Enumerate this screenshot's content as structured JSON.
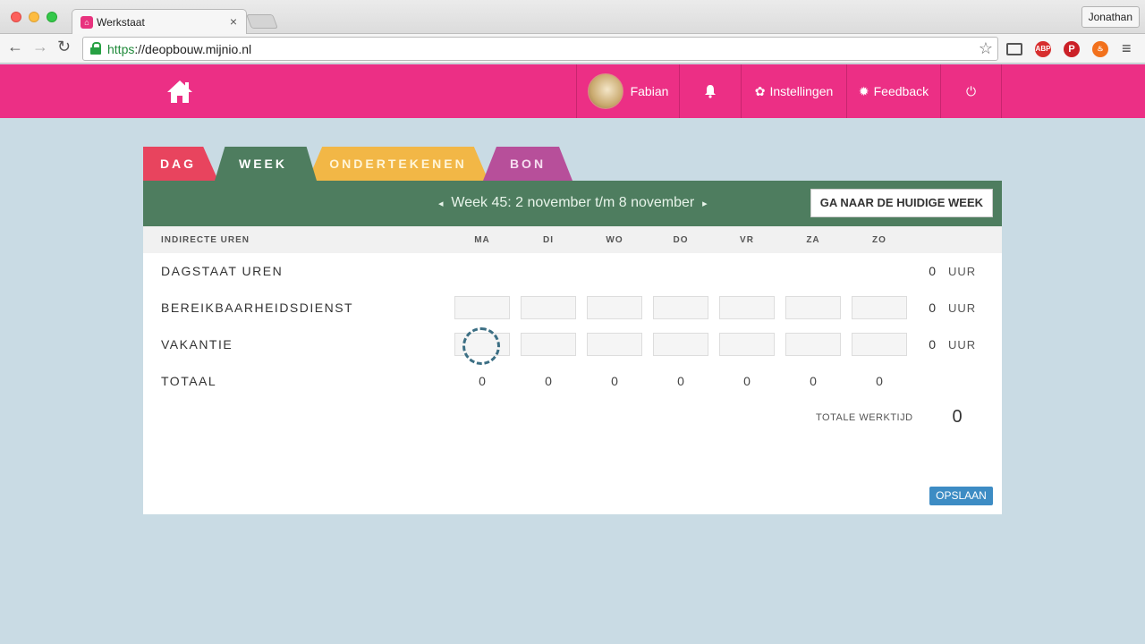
{
  "browser": {
    "tab_title": "Werkstaat",
    "tab_close": "×",
    "favicon": "⌂",
    "profile": "Jonathan",
    "url_scheme": "https",
    "url_rest": "://deopbouw.mijnio.nl",
    "nav_back": "←",
    "nav_forward": "→",
    "nav_reload": "↻",
    "star": "☆",
    "menu": "≡",
    "ext_abp": "ABP",
    "ext_pinterest": "P",
    "ext_fire": "♨"
  },
  "header": {
    "user_name": "Fabian",
    "settings_label": "Instellingen",
    "feedback_label": "Feedback",
    "settings_icon": "✿",
    "feedback_icon": "✹",
    "power_icon": "⏻",
    "color": "#ec2f85"
  },
  "tabs": [
    {
      "label": "DAG"
    },
    {
      "label": "WEEK"
    },
    {
      "label": "ONDERTEKENEN"
    },
    {
      "label": "BON"
    }
  ],
  "week": {
    "prev": "◂",
    "next": "▸",
    "label": "Week 45: 2 november t/m 8 november",
    "goto_label": "GA NAAR DE HUIDIGE WEEK"
  },
  "table": {
    "header_label": "INDIRECTE UREN",
    "days": [
      "MA",
      "DI",
      "WO",
      "DO",
      "VR",
      "ZA",
      "ZO"
    ],
    "rows": [
      {
        "label": "DAGSTAAT UREN",
        "total": "0",
        "unit": "UUR"
      },
      {
        "label": "BEREIKBAARHEIDSDIENST",
        "total": "0",
        "unit": "UUR"
      },
      {
        "label": "VAKANTIE",
        "total": "0",
        "unit": "UUR"
      }
    ],
    "totals_label": "TOTAAL",
    "totals": [
      "0",
      "0",
      "0",
      "0",
      "0",
      "0",
      "0"
    ],
    "totale_werktijd_label": "TOTALE WERKTIJD",
    "totale_werktijd_value": "0"
  },
  "actions": {
    "save_label": "OPSLAAN"
  }
}
